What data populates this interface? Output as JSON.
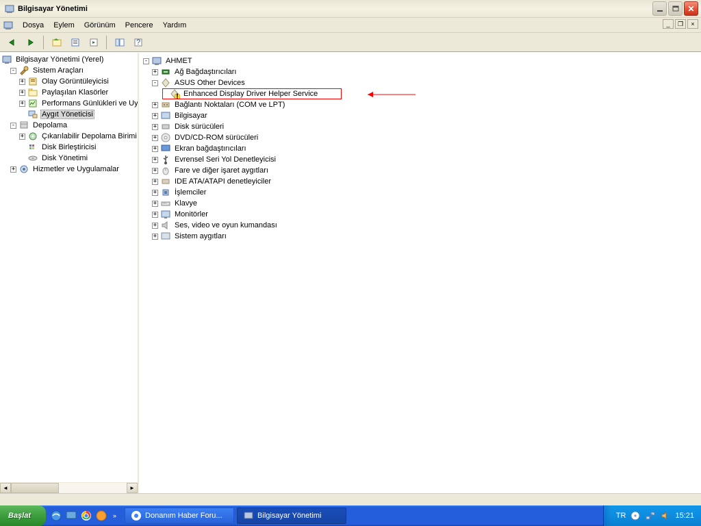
{
  "window": {
    "title": "Bilgisayar Yönetimi"
  },
  "menu": {
    "items": [
      "Dosya",
      "Eylem",
      "Görünüm",
      "Pencere",
      "Yardım"
    ]
  },
  "left_tree": {
    "root": "Bilgisayar Yönetimi (Yerel)",
    "sys_tools": "Sistem Araçları",
    "event_viewer": "Olay Görüntüleyicisi",
    "shared_folders": "Paylaşılan Klasörler",
    "perf_logs": "Performans Günlükleri ve Uy",
    "device_mgr": "Aygıt Yöneticisi",
    "storage": "Depolama",
    "removable": "Çıkarılabilir Depolama Birimi",
    "disk_defrag": "Disk Birleştiricisi",
    "disk_mgmt": "Disk Yönetimi",
    "services": "Hizmetler ve Uygulamalar"
  },
  "right_tree": {
    "computer": "AHMET",
    "net_adapters": "Ağ Bağdaştırıcıları",
    "asus_other": "ASUS Other Devices",
    "enhanced_display": "Enhanced Display Driver Helper Service",
    "ports": "Bağlantı Noktaları (COM ve LPT)",
    "computers": "Bilgisayar",
    "disk_drives": "Disk sürücüleri",
    "dvd": "DVD/CD-ROM sürücüleri",
    "display": "Ekran bağdaştırıcıları",
    "usb": "Evrensel Seri Yol Denetleyicisi",
    "mice": "Fare ve diğer işaret aygıtları",
    "ide": "IDE ATA/ATAPI denetleyiciler",
    "processors": "İşlemciler",
    "keyboards": "Klavye",
    "monitors": "Monitörler",
    "sound": "Ses, video ve oyun kumandası",
    "system": "Sistem aygıtları"
  },
  "taskbar": {
    "start": "Başlat",
    "task1": "Donanım Haber Foru...",
    "task2": "Bilgisayar Yönetimi",
    "lang": "TR",
    "clock": "15:21"
  }
}
